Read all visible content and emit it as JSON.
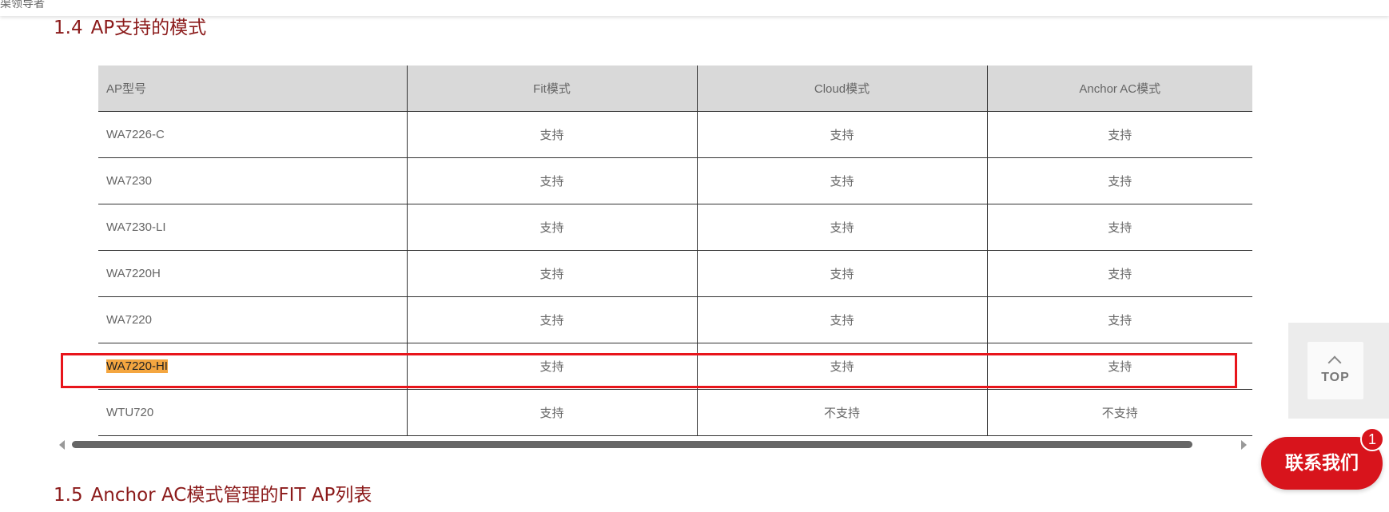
{
  "header": {
    "partial_text": "渠领导者"
  },
  "section1": {
    "number": "1.4",
    "title": "AP支持的模式"
  },
  "table": {
    "columns": [
      "AP型号",
      "Fit模式",
      "Cloud模式",
      "Anchor AC模式"
    ],
    "rows": [
      [
        "WA7226-C",
        "支持",
        "支持",
        "支持"
      ],
      [
        "WA7230",
        "支持",
        "支持",
        "支持"
      ],
      [
        "WA7230-LI",
        "支持",
        "支持",
        "支持"
      ],
      [
        "WA7220H",
        "支持",
        "支持",
        "支持"
      ],
      [
        "WA7220",
        "支持",
        "支持",
        "支持"
      ],
      [
        "WA7220-HI",
        "支持",
        "支持",
        "支持"
      ],
      [
        "WTU720",
        "支持",
        "不支持",
        "不支持"
      ]
    ]
  },
  "section2": {
    "number": "1.5",
    "title": "Anchor AC模式管理的FIT AP列表"
  },
  "back_to_top": {
    "label": "TOP"
  },
  "contact": {
    "label": "联系我们",
    "badge": "1"
  },
  "colors": {
    "title": "#8b1a1a",
    "highlight": "#f4a640",
    "red_box": "#e8151b",
    "contact_bg": "#d8141c",
    "header_bg": "#d9d9d9"
  }
}
